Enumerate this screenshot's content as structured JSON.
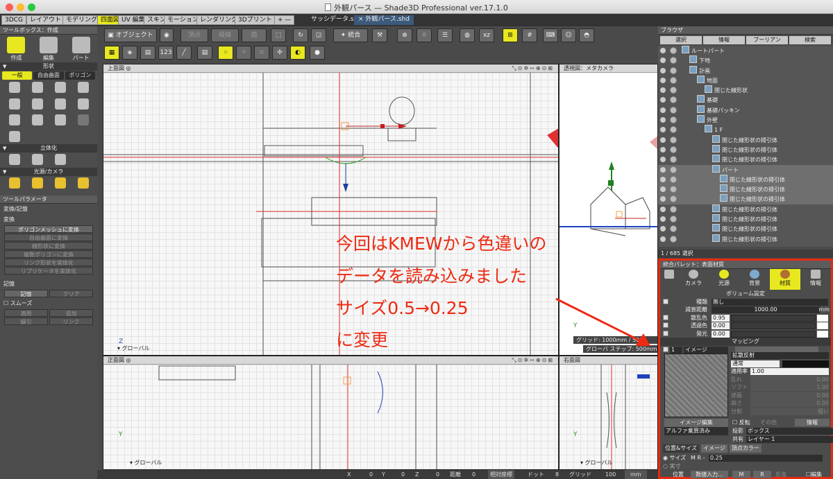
{
  "window": {
    "title": "外観パース — Shade3D Professional ver.17.1.0"
  },
  "mode_tabs": [
    "3DCG",
    "レイアウト",
    "モデリング",
    "四面図",
    "UV 編集",
    "スキン",
    "モーション",
    "レンダリング",
    "3Dプリント",
    "+ —"
  ],
  "doc_tabs": [
    "サッシデータ.shd",
    "× 外観パース.shd"
  ],
  "toolbox": {
    "title": "ツールボックス：作成",
    "big_buttons": [
      "作成",
      "編集",
      "パート"
    ],
    "shape_section": "形状",
    "subtabs": [
      "一般",
      "自由曲面",
      "ポリゴン"
    ],
    "solid_section": "立体化",
    "light_section": "光源/カメラ"
  },
  "tool_params": {
    "title": "ツールパラメータ",
    "subtitle": "変換/記憶",
    "convert_label": "変換",
    "convert_buttons": [
      "ポリゴンメッシュに変換",
      "自由曲面に変換",
      "線形状に変換",
      "複数ポリゴンに変換",
      "リンク形状を実体化",
      "リプリケータを実体化"
    ],
    "memory_label": "記憶",
    "memory_row": [
      "記憶",
      "クリア"
    ],
    "smooth_label": "スムーズ",
    "smooth_row1": [
      "適用",
      "追加"
    ],
    "smooth_row2": [
      "繰引",
      "リンク"
    ]
  },
  "toolbar": {
    "object_label": "オブジェクト",
    "point_label": "頂点",
    "edge_label": "稜線",
    "face_label": "面",
    "integrate_label": "統合"
  },
  "viewports": {
    "top": {
      "title": "上面図",
      "axis": "グローバル"
    },
    "persp": {
      "title": "透視図：メタカメラ",
      "grid_info": "グリッド: 1000mm / 500...",
      "snap_info": "グローバ  ステップ: 500mm"
    },
    "front": {
      "title": "正面図",
      "axis": "グローバル"
    },
    "side": {
      "title": "右面図",
      "axis": "グローバル"
    }
  },
  "browser": {
    "title": "ブラウザ",
    "tabs": [
      "選択",
      "情報",
      "ブーリアン",
      "検索"
    ],
    "tree": [
      {
        "label": "ルートパート",
        "indent": 0
      },
      {
        "label": "下地",
        "indent": 1
      },
      {
        "label": "計画",
        "indent": 1
      },
      {
        "label": "地面",
        "indent": 2
      },
      {
        "label": "閉じた線形状",
        "indent": 3
      },
      {
        "label": "基礎",
        "indent": 2
      },
      {
        "label": "基礎パッキン",
        "indent": 2
      },
      {
        "label": "外壁",
        "indent": 2
      },
      {
        "label": "1 F",
        "indent": 3
      },
      {
        "label": "閉じた線形状の掃引体",
        "indent": 4
      },
      {
        "label": "閉じた線形状の掃引体",
        "indent": 4
      },
      {
        "label": "閉じた線形状の掃引体",
        "indent": 4
      },
      {
        "label": "パート",
        "indent": 4,
        "hl": true
      },
      {
        "label": "閉じた線形状の掃引体",
        "indent": 5,
        "hl": true
      },
      {
        "label": "閉じた線形状の掃引体",
        "indent": 5,
        "hl": true
      },
      {
        "label": "閉じた線形状の掃引体",
        "indent": 5,
        "hl": true
      },
      {
        "label": "閉じた線形状の掃引体",
        "indent": 4
      },
      {
        "label": "閉じた線形状の掃引体",
        "indent": 4
      },
      {
        "label": "閉じた線形状の掃引体",
        "indent": 4
      },
      {
        "label": "閉じた線形状の掃引体",
        "indent": 4
      }
    ],
    "selection": "1 / 685 選択"
  },
  "palette": {
    "title": "統合パレット：表面材質",
    "tabs": [
      "カメラ",
      "光源",
      "背景",
      "材質",
      "情報"
    ],
    "section_volume": "ボリューム設定",
    "kind_label": "種類",
    "kind_value": "無し",
    "attenuation_label": "減衰距離",
    "attenuation_value": "1000.00",
    "attenuation_unit": "mm",
    "scatter_label": "散乱色",
    "scatter_value": "0.95",
    "transmit_label": "透過色",
    "transmit_value": "0.00",
    "emit_label": "発光",
    "emit_value": "0.00",
    "mapping_label": "マッピング",
    "layer_index": "1",
    "layer_type": "イメージ",
    "map_type": "拡散反射",
    "blend": "通常",
    "apply_label": "適用率",
    "apply_value": "1.00",
    "disabled_rows": [
      "乱れ",
      "ソフト",
      "遮蔽",
      "高さ",
      "分割"
    ],
    "disabled_values": [
      "0.00",
      "1.00",
      "0.00",
      "0.00",
      "粗い"
    ],
    "image_edit": "イメージ編集",
    "alpha": "アルファ乗算済み",
    "reverse_label": "反転",
    "other_label": "その他",
    "info_btn": "情報",
    "projection_label": "投影",
    "projection_value": "ボックス",
    "share_label": "共有",
    "share_value": "レイヤー 1",
    "subtabs": [
      "位置&サイズ",
      "イメージ",
      "頂点カラー"
    ],
    "size_label": "サイズ",
    "size_value": "0.25",
    "actual_label": "実寸",
    "position_label": "位置",
    "numeric_input": "数値入力...",
    "repeat_label": "反復",
    "edit_label": "編集"
  },
  "statusbar": {
    "x_label": "X",
    "x_value": "0",
    "y_label": "Y",
    "y_value": "0",
    "z_label": "Z",
    "z_value": "0",
    "dist_label": "距離",
    "dist_value": "0",
    "coord": "相対座標",
    "dot_label": "ドット",
    "dot_value": "8",
    "grid_label": "グリッド",
    "grid_value": "100",
    "unit": "mm"
  },
  "annotation": {
    "lines": [
      "今回はKMEWから色違いの",
      "データを読み込みました",
      "サイズ0.5→0.25",
      "に変更"
    ]
  },
  "colors": {
    "accent_yellow": "#e8e820",
    "annotation_red": "#ee2a12",
    "selection_blue": "#3c5a7a"
  }
}
